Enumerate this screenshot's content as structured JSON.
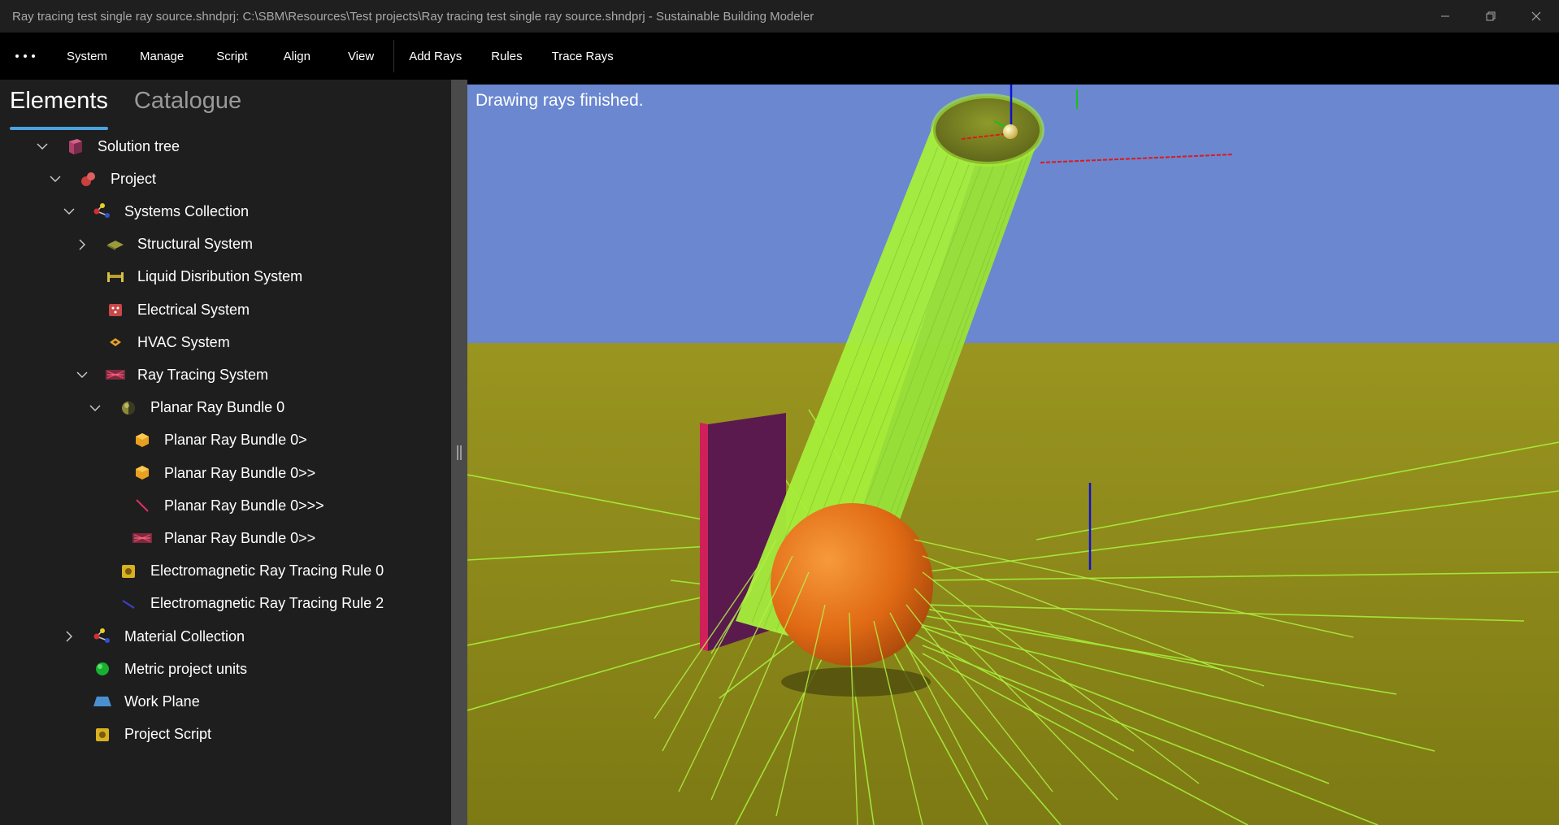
{
  "window": {
    "title": "Ray tracing test single ray source.shndprj:  C:\\SBM\\Resources\\Test projects\\Ray tracing test single ray source.shndprj - Sustainable Building Modeler"
  },
  "menu": {
    "items": [
      "System",
      "Manage",
      "Script",
      "Align",
      "View",
      "Add Rays",
      "Rules",
      "Trace Rays"
    ]
  },
  "tabs": {
    "elements": "Elements",
    "catalogue": "Catalogue",
    "active": "Elements"
  },
  "tree": {
    "nodes": [
      {
        "label": "Solution tree",
        "level": 0,
        "expander": "expanded",
        "icon": "solution-cube-icon"
      },
      {
        "label": "Project",
        "level": 1,
        "expander": "expanded",
        "icon": "project-spheres-icon"
      },
      {
        "label": "Systems Collection",
        "level": 2,
        "expander": "expanded",
        "icon": "systems-graph-icon"
      },
      {
        "label": "Structural System",
        "level": 3,
        "expander": "collapsed",
        "icon": "structural-system-icon"
      },
      {
        "label": "Liquid Disribution System",
        "level": 3,
        "expander": "none",
        "icon": "liquid-distribution-icon"
      },
      {
        "label": "Electrical System",
        "level": 3,
        "expander": "none",
        "icon": "electrical-system-icon"
      },
      {
        "label": "HVAC System",
        "level": 3,
        "expander": "none",
        "icon": "hvac-system-icon"
      },
      {
        "label": "Ray Tracing System",
        "level": 3,
        "expander": "expanded",
        "icon": "ray-tracing-system-icon"
      },
      {
        "label": "Planar Ray Bundle 0",
        "level": 4,
        "expander": "expanded",
        "icon": "ray-bundle-sphere-icon"
      },
      {
        "label": "Planar Ray Bundle 0>",
        "level": 5,
        "expander": "none",
        "icon": "ray-source-box-icon"
      },
      {
        "label": "Planar Ray Bundle 0>>",
        "level": 5,
        "expander": "none",
        "icon": "ray-source-box-icon"
      },
      {
        "label": "Planar Ray Bundle 0>>>",
        "level": 5,
        "expander": "none",
        "icon": "ray-line-icon"
      },
      {
        "label": "Planar Ray Bundle 0>>",
        "level": 5,
        "expander": "none",
        "icon": "ray-tracing-system-icon"
      },
      {
        "label": "Electromagnetic Ray Tracing Rule 0",
        "level": 4,
        "expander": "none",
        "icon": "script-rule-icon"
      },
      {
        "label": "Electromagnetic Ray Tracing Rule 2",
        "level": 4,
        "expander": "none",
        "icon": "ray-line-blue-icon"
      },
      {
        "label": "Material Collection",
        "level": 2,
        "expander": "collapsed",
        "icon": "material-graph-icon"
      },
      {
        "label": "Metric project units",
        "level": 2,
        "expander": "none",
        "icon": "units-green-icon"
      },
      {
        "label": "Work Plane",
        "level": 2,
        "expander": "none",
        "icon": "work-plane-icon"
      },
      {
        "label": "Project Script",
        "level": 2,
        "expander": "none",
        "icon": "script-rule-icon"
      }
    ]
  },
  "viewport": {
    "status": "Drawing rays finished."
  },
  "colors": {
    "sky": "#6a87d0",
    "ground": "#8e8a18",
    "rays": "#a7ef3a",
    "sphere": "#e1751c",
    "panel": "#5b1a4e",
    "tab_underline": "#4aa3df"
  }
}
